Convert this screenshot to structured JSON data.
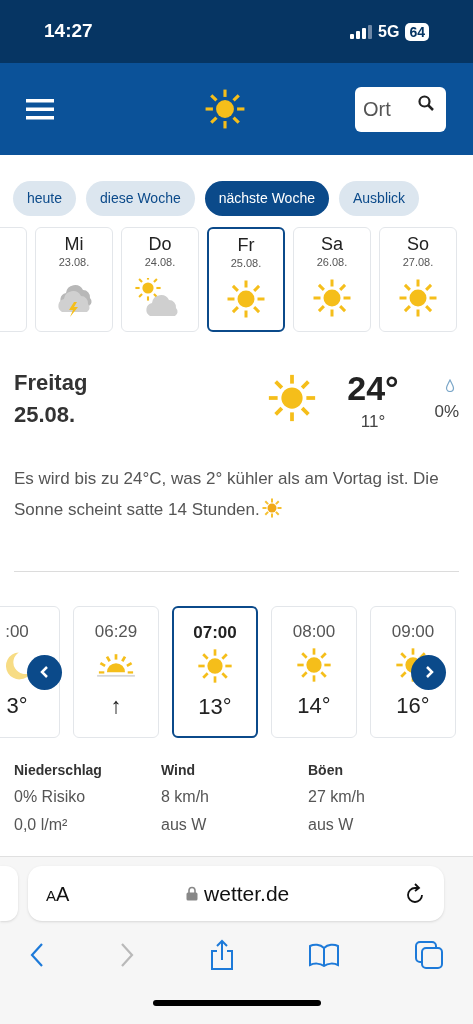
{
  "status_bar": {
    "time": "14:27",
    "network": "5G",
    "battery": "64"
  },
  "header": {
    "search": {
      "placeholder": "Ort"
    }
  },
  "tabs": [
    {
      "label": "heute",
      "selected": false
    },
    {
      "label": "diese Woche",
      "selected": false
    },
    {
      "label": "nächste Woche",
      "selected": true
    },
    {
      "label": "Ausblick",
      "selected": false
    }
  ],
  "days": [
    {
      "name": "Mi",
      "date": "23.08.",
      "kind": "thunder",
      "selected": false
    },
    {
      "name": "Do",
      "date": "24.08.",
      "kind": "partly",
      "selected": false
    },
    {
      "name": "Fr",
      "date": "25.08.",
      "kind": "sun",
      "selected": true
    },
    {
      "name": "Sa",
      "date": "26.08.",
      "kind": "sun",
      "selected": false
    },
    {
      "name": "So",
      "date": "27.08.",
      "kind": "sun",
      "selected": false
    }
  ],
  "detail": {
    "day": "Freitag",
    "date": "25.08.",
    "kind": "sun",
    "high": "24°",
    "low": "11°",
    "precipitation": "0%"
  },
  "description": "Es wird bis zu 24°C, was 2° kühler als am Vortag ist. Die Sonne scheint satte 14 Stunden.",
  "hours": [
    {
      "time": ":00",
      "kind": "moon",
      "temp": "3°",
      "selected": false
    },
    {
      "time": "06:29",
      "kind": "sunrise",
      "temp": "↑",
      "selected": false
    },
    {
      "time": "07:00",
      "kind": "sun",
      "temp": "13°",
      "selected": true
    },
    {
      "time": "08:00",
      "kind": "sun",
      "temp": "14°",
      "selected": false
    },
    {
      "time": "09:00",
      "kind": "sun",
      "temp": "16°",
      "selected": false
    }
  ],
  "stats": [
    {
      "label": "Niederschlag",
      "lines": [
        "0% Risiko",
        "0,0 l/m²"
      ]
    },
    {
      "label": "Wind",
      "lines": [
        "8 km/h",
        "aus W"
      ]
    },
    {
      "label": "Böen",
      "lines": [
        "27 km/h",
        "aus W"
      ]
    }
  ],
  "browser": {
    "text_size": "AA",
    "url": "wetter.de"
  }
}
